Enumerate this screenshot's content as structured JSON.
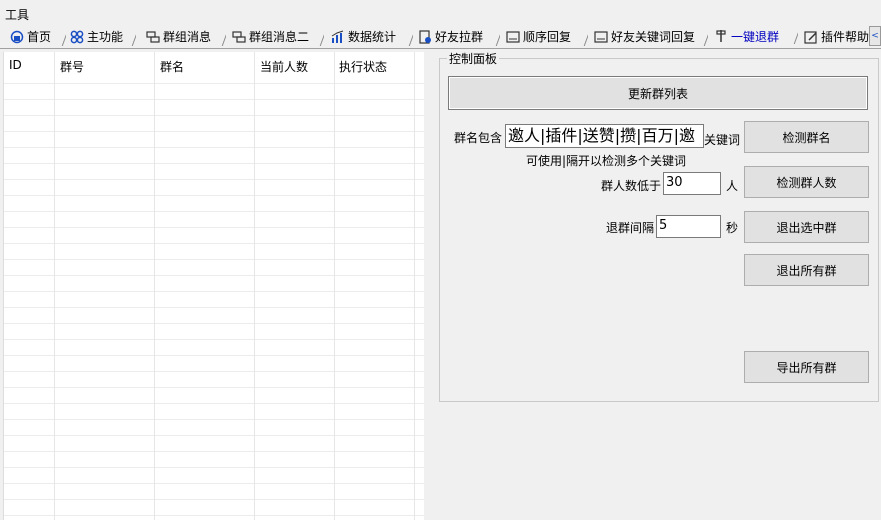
{
  "menubar": {
    "tools": "工具"
  },
  "tabs": [
    {
      "label": "首页",
      "icon": "home-icon"
    },
    {
      "label": "主功能",
      "icon": "grid-icon"
    },
    {
      "label": "群组消息",
      "icon": "chat-icon"
    },
    {
      "label": "群组消息二",
      "icon": "chat-icon"
    },
    {
      "label": "数据统计",
      "icon": "chart-icon"
    },
    {
      "label": "好友拉群",
      "icon": "document-icon"
    },
    {
      "label": "顺序回复",
      "icon": "reply-icon"
    },
    {
      "label": "好友关键词回复",
      "icon": "reply-icon"
    },
    {
      "label": "一键退群",
      "icon": "pin-icon"
    },
    {
      "label": "插件帮助",
      "icon": "edit-icon"
    }
  ],
  "table": {
    "columns": [
      "ID",
      "群号",
      "群名",
      "当前人数",
      "执行状态"
    ]
  },
  "panel": {
    "title": "控制面板",
    "refresh_button": "更新群列表",
    "keyword_label": "群名包含",
    "keyword_value": "邀人|插件|送赞|攒|百万|邀",
    "keyword_suffix": "关键词",
    "hint": "可使用|隔开以检测多个关键词",
    "detect_name_button": "检测群名",
    "member_label": "群人数低于",
    "member_value": "30",
    "member_unit": "人",
    "detect_count_button": "检测群人数",
    "interval_label": "退群间隔",
    "interval_value": "5",
    "interval_unit": "秒",
    "exit_selected_button": "退出选中群",
    "exit_all_button": "退出所有群",
    "export_button": "导出所有群"
  },
  "tab_scroll": {
    "left_arrow": "<"
  }
}
